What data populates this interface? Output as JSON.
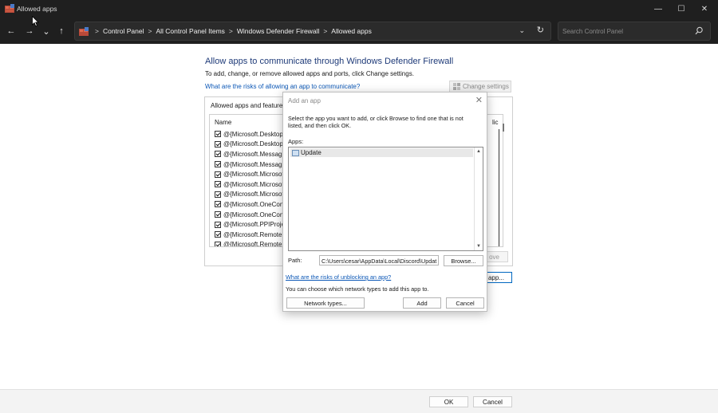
{
  "window": {
    "title": "Allowed apps",
    "controls": {
      "minimize": "—",
      "maximize": "☐",
      "close": "✕"
    }
  },
  "addressbar": {
    "back": "←",
    "forward": "→",
    "recent": "⌄",
    "up": "↑",
    "breadcrumbs": [
      "Control Panel",
      "All Control Panel Items",
      "Windows Defender Firewall",
      "Allowed apps"
    ],
    "separator": ">",
    "dropdown": "⌄",
    "refresh": "↻",
    "search_placeholder": "Search Control Panel"
  },
  "main": {
    "title": "Allow apps to communicate through Windows Defender Firewall",
    "description": "To add, change, or remove allowed apps and ports, click Change settings.",
    "risk_link": "What are the risks of allowing an app to communicate?",
    "change_settings_label": "Change settings",
    "group_label": "Allowed apps and feature",
    "columns": {
      "name": "Name",
      "public": "lic"
    },
    "rows": [
      "@{Microsoft.Desktop",
      "@{Microsoft.Desktop",
      "@{Microsoft.Messagi",
      "@{Microsoft.Messagi",
      "@{Microsoft.Microsof",
      "@{Microsoft.Microsof",
      "@{Microsoft.Microsof",
      "@{Microsoft.OneCon",
      "@{Microsoft.OneCon",
      "@{Microsoft.PPIProje",
      "@{Microsoft.Remotel",
      "@{Microsoft.RemoteD"
    ],
    "remove_label": "ove",
    "allow_another_label": "app..."
  },
  "dialog": {
    "title": "Add an app",
    "close": "✕",
    "instructions": "Select the app you want to add, or click Browse to find one that is not listed, and then click OK.",
    "apps_label": "Apps:",
    "apps": [
      "Update"
    ],
    "path_label": "Path:",
    "path_value": "C:\\Users\\cesar\\AppData\\Local\\Discord\\Updat",
    "browse_label": "Browse...",
    "unblock_link": "What are the risks of unblocking an app?",
    "network_desc": "You can choose which network types to add this app to.",
    "network_types_label": "Network types...",
    "add_label": "Add",
    "cancel_label": "Cancel"
  },
  "footer": {
    "ok_label": "OK",
    "cancel_label": "Cancel"
  },
  "colors": {
    "accent": "#0067c0",
    "link": "#0b57b6",
    "title_blue": "#1e3a78",
    "chrome": "#1f1f1f"
  }
}
